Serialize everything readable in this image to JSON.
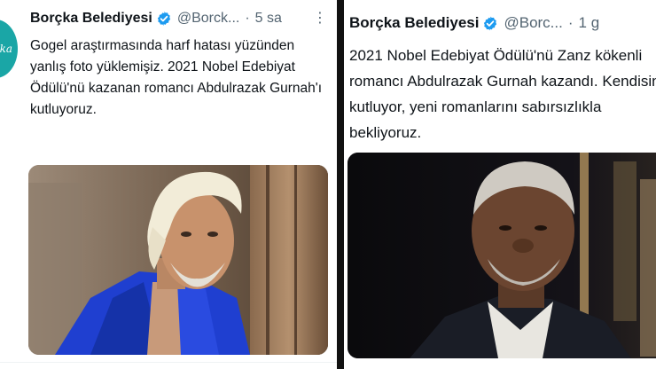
{
  "left_tweet": {
    "display_name": "Borçka Belediyesi",
    "handle": "@Borck...",
    "separator": "·",
    "time": "5 sa",
    "more": "⋮",
    "avatar_text": "ka",
    "text": "Gogel araştırmasında harf hatası yüzünden yanlış foto yüklemişiz. 2021 Nobel Edebiyat Ödülü'nü kazanan romancı Abdulrazak Gurnah'ı kutluyoruz."
  },
  "right_tweet": {
    "display_name": "Borçka Belediyesi",
    "handle": "@Borc...",
    "separator": "·",
    "time": "1 g",
    "text": "2021 Nobel Edebiyat Ödülü'nü Zanz kökenli romancı Abdulrazak Gurnah kazandı. Kendisini kutluyor, yeni romanlarını sabırsızlıkla bekliyoruz."
  },
  "colors": {
    "verified": "#1d9bf0",
    "secondary_text": "#536471",
    "avatar": "#1aa6a6",
    "divider": "#111111"
  },
  "icons": {
    "verified": "verified-badge-icon",
    "more": "more-options-icon"
  }
}
